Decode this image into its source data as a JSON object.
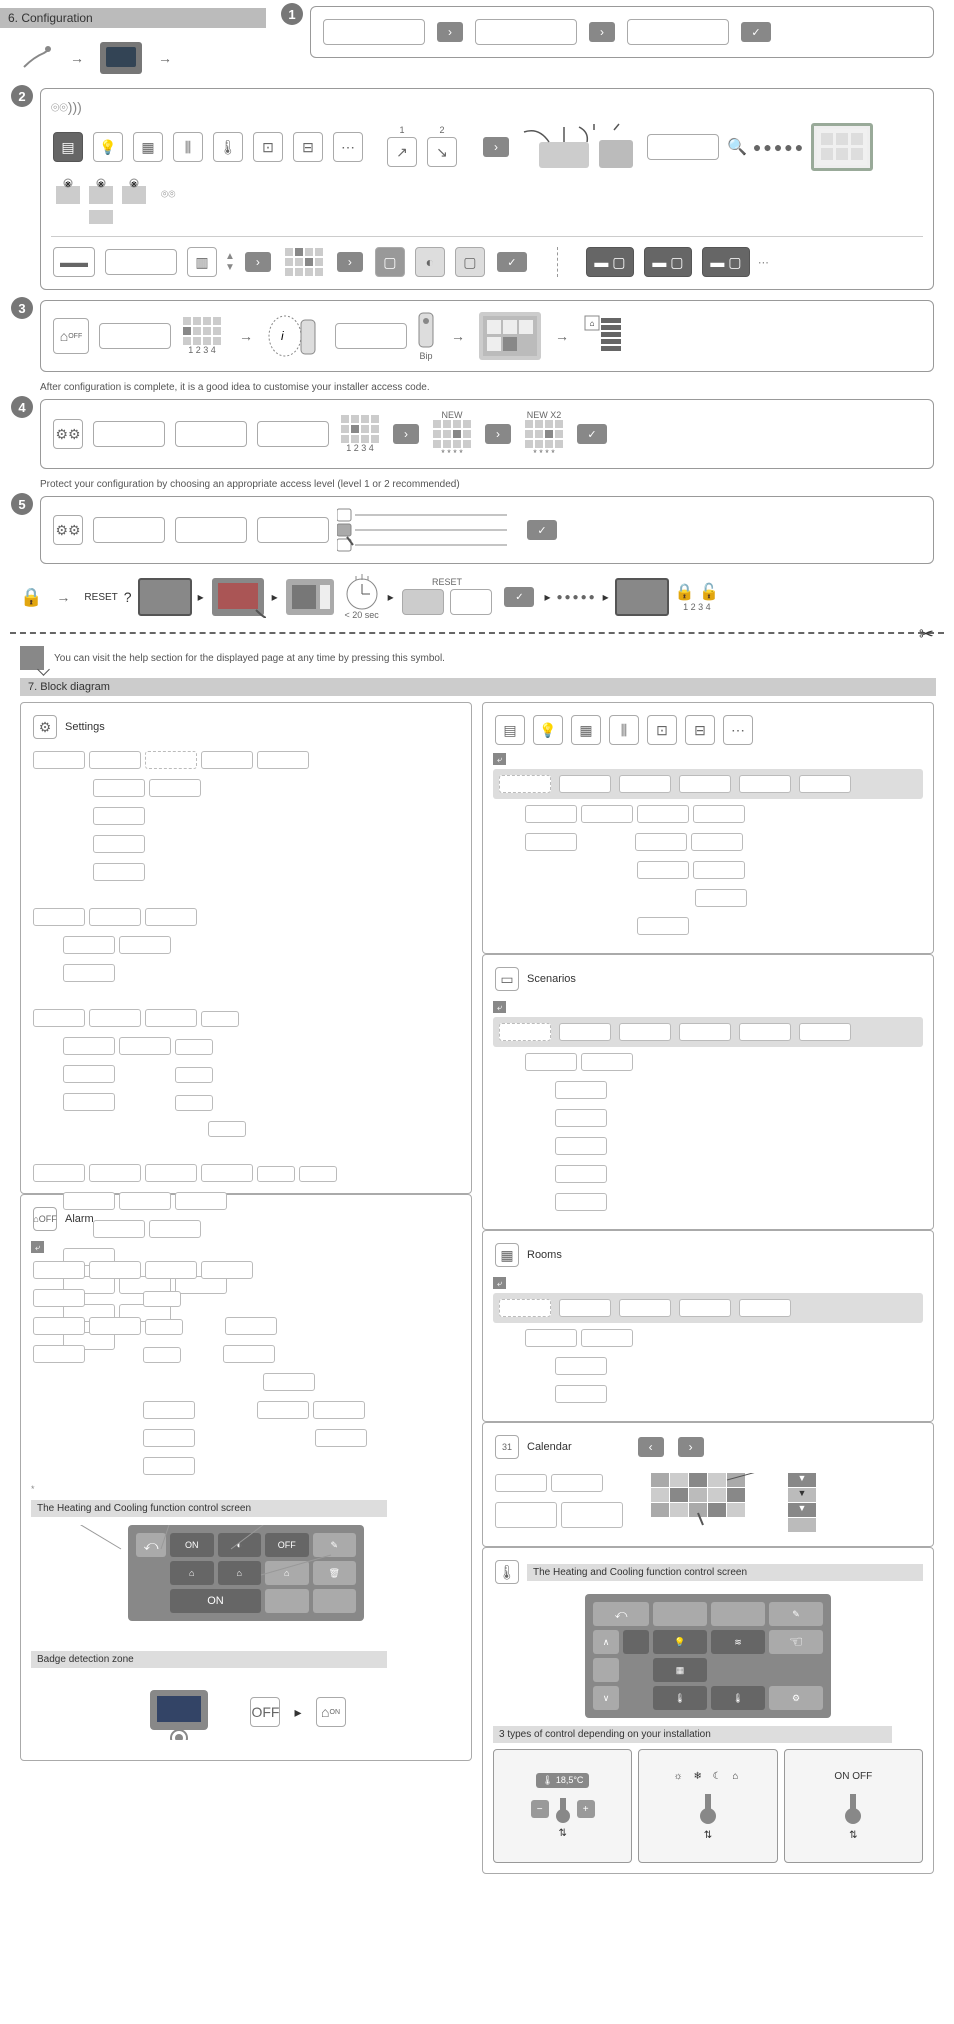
{
  "sections": {
    "config_title": "6. Configuration",
    "block_title": "7. Block diagram"
  },
  "steps": {
    "s1": "1",
    "s2": "2",
    "s3": "3",
    "s4": "4",
    "s5": "5",
    "numbers_1234": "1 2 3 4",
    "bip": "Bip",
    "new": "NEW",
    "new_x2": "NEW X2",
    "stars": "* * * *",
    "time_limit": "< 20 sec",
    "reset": "RESET",
    "reset2": "RESET",
    "step2_sub1": "1",
    "step2_sub2": "2"
  },
  "notes": {
    "after_config": "After configuration is complete, it is a good idea to customise your installer access code.",
    "protect": "Protect your configuration by choosing an appropriate access level (level 1 or 2 recommended)",
    "help": "You can visit the help section for the displayed page at any time by pressing this symbol."
  },
  "diagrams": {
    "settings": "Settings",
    "alarm": "Alarm",
    "scenarios": "Scenarios",
    "rooms": "Rooms",
    "calendar": "Calendar",
    "heating_title": "The Heating and Cooling function control screen",
    "badge_zone": "Badge detection zone",
    "three_types": "3 types of control depending on your installation",
    "on": "ON",
    "off": "OFF",
    "on_off": "ON   OFF",
    "thermo_icons": "☼ ❄ ☾ ⌂",
    "temp": "18,5°C"
  }
}
